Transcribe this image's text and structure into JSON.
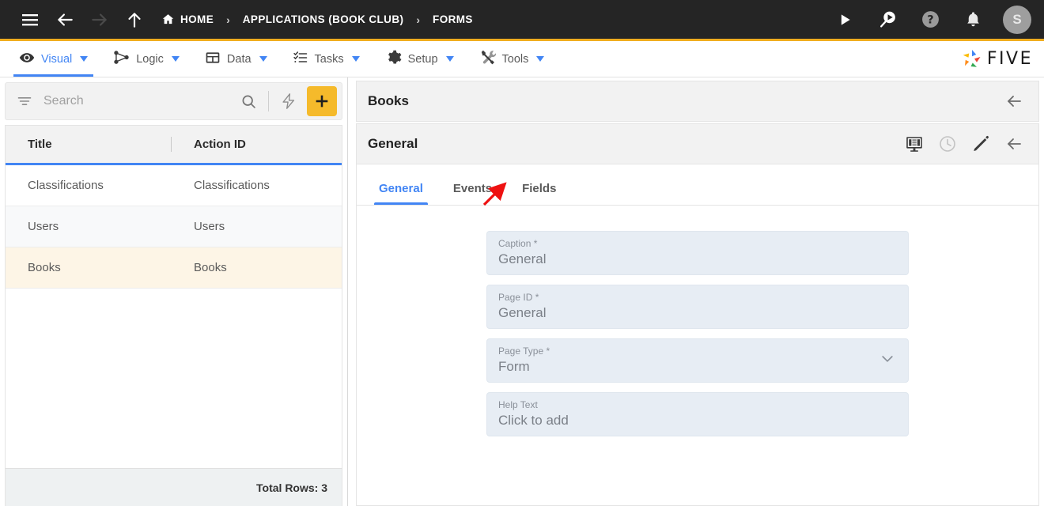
{
  "topbar": {
    "menu_icon": "hamburger-icon",
    "back_icon": "arrow-left-icon",
    "forward_icon": "arrow-right-icon",
    "up_icon": "arrow-up-icon",
    "breadcrumbs": [
      {
        "label": "HOME",
        "icon": "home-icon"
      },
      {
        "label": "APPLICATIONS (BOOK CLUB)",
        "icon": ""
      },
      {
        "label": "FORMS",
        "icon": ""
      }
    ],
    "separator": "›",
    "actions": [
      {
        "name": "run-icon",
        "title": "Run"
      },
      {
        "name": "search-run-icon",
        "title": "Search"
      },
      {
        "name": "help-icon",
        "title": "Help"
      },
      {
        "name": "notifications-bell-icon",
        "title": "Notifications"
      }
    ],
    "avatar_initial": "S",
    "accent_bar_color": "#f0ad1e",
    "background": "#252525"
  },
  "menubar": {
    "items": [
      {
        "label": "Visual",
        "icon": "eye-icon",
        "active": true
      },
      {
        "label": "Logic",
        "icon": "node-graph-icon",
        "active": false
      },
      {
        "label": "Data",
        "icon": "table-grid-icon",
        "active": false
      },
      {
        "label": "Tasks",
        "icon": "checklist-icon",
        "active": false
      },
      {
        "label": "Setup",
        "icon": "gear-icon",
        "active": false
      },
      {
        "label": "Tools",
        "icon": "wrench-screwdriver-icon",
        "active": false
      }
    ],
    "brand": "FIVE",
    "active_color": "#4285f4"
  },
  "sidebar": {
    "search": {
      "value": "",
      "placeholder": "Search"
    },
    "filter_icon": "filter-icon",
    "search_icon": "search-icon",
    "lightning_icon": "lightning-bolt-icon",
    "add_label": "+",
    "grid": {
      "columns": [
        "Title",
        "Action ID"
      ],
      "rows": [
        {
          "title": "Classifications",
          "action_id": "Classifications",
          "selected": false
        },
        {
          "title": "Users",
          "action_id": "Users",
          "selected": false
        },
        {
          "title": "Books",
          "action_id": "Books",
          "selected": true
        }
      ]
    },
    "footer": {
      "total_rows": "Total Rows: 3"
    },
    "selected_row_color": "#fdf5e6"
  },
  "detail": {
    "record_header": {
      "title": "Books",
      "back_icon": "arrow-left-icon"
    },
    "page_header": {
      "title": "General",
      "actions": [
        {
          "name": "preview-monitor-icon",
          "enabled": true
        },
        {
          "name": "history-clock-icon",
          "enabled": false
        },
        {
          "name": "edit-pencil-icon",
          "enabled": true
        },
        {
          "name": "arrow-left-icon",
          "enabled": true
        }
      ]
    },
    "tabs": [
      {
        "label": "General",
        "active": true
      },
      {
        "label": "Events",
        "active": false
      },
      {
        "label": "Fields",
        "active": false
      }
    ],
    "fields": [
      {
        "label": "Caption *",
        "value": "General",
        "type": "text"
      },
      {
        "label": "Page ID *",
        "value": "General",
        "type": "text"
      },
      {
        "label": "Page Type *",
        "value": "Form",
        "type": "select"
      },
      {
        "label": "Help Text",
        "value": "Click to add",
        "type": "text"
      }
    ]
  },
  "annotation": {
    "arrow_color": "#ee1111",
    "points_to": "Fields"
  }
}
